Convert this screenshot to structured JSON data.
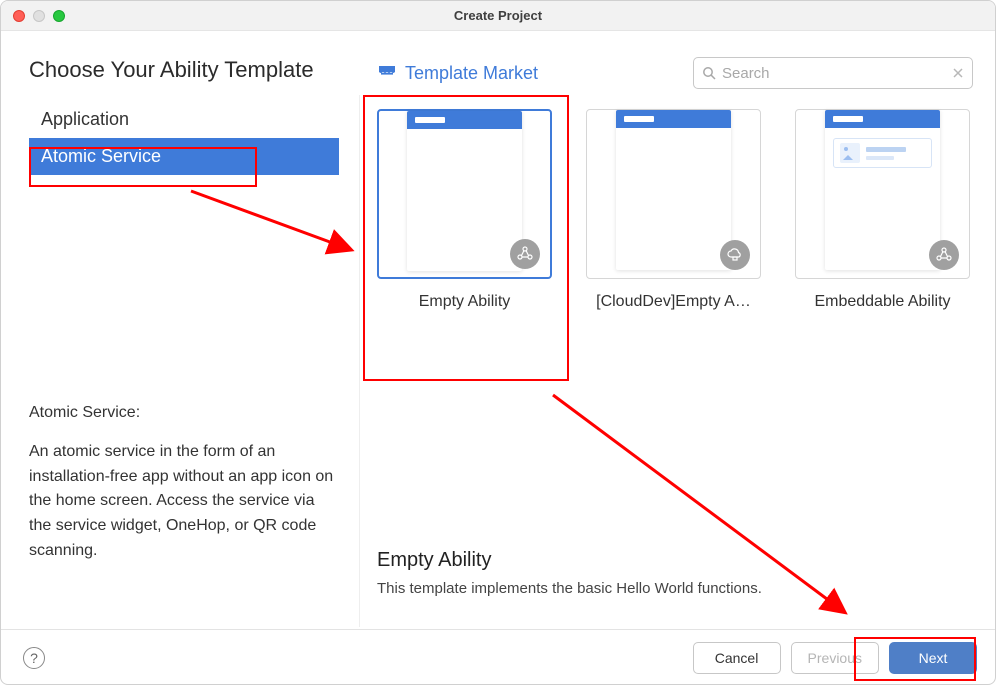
{
  "window": {
    "title": "Create Project"
  },
  "heading": "Choose Your Ability Template",
  "nav": {
    "items": [
      {
        "label": "Application",
        "selected": false
      },
      {
        "label": "Atomic Service",
        "selected": true
      }
    ]
  },
  "description": {
    "title": "Atomic Service:",
    "body": "An atomic service in the form of an installation-free app without an app icon on the home screen. Access the service via the service widget, OneHop, or QR code scanning."
  },
  "market_link": "Template Market",
  "search": {
    "placeholder": "Search",
    "value": ""
  },
  "templates": [
    {
      "label": "Empty Ability",
      "selected": true,
      "badge": "share"
    },
    {
      "label": "[CloudDev]Empty A…",
      "selected": false,
      "badge": "cloud"
    },
    {
      "label": "Embeddable Ability",
      "selected": false,
      "badge": "share"
    }
  ],
  "detail": {
    "title": "Empty Ability",
    "body": "This template implements the basic Hello World functions."
  },
  "footer": {
    "cancel": "Cancel",
    "previous": "Previous",
    "next": "Next"
  },
  "colors": {
    "accent": "#3f7bd9",
    "annotation": "#ff0000"
  }
}
